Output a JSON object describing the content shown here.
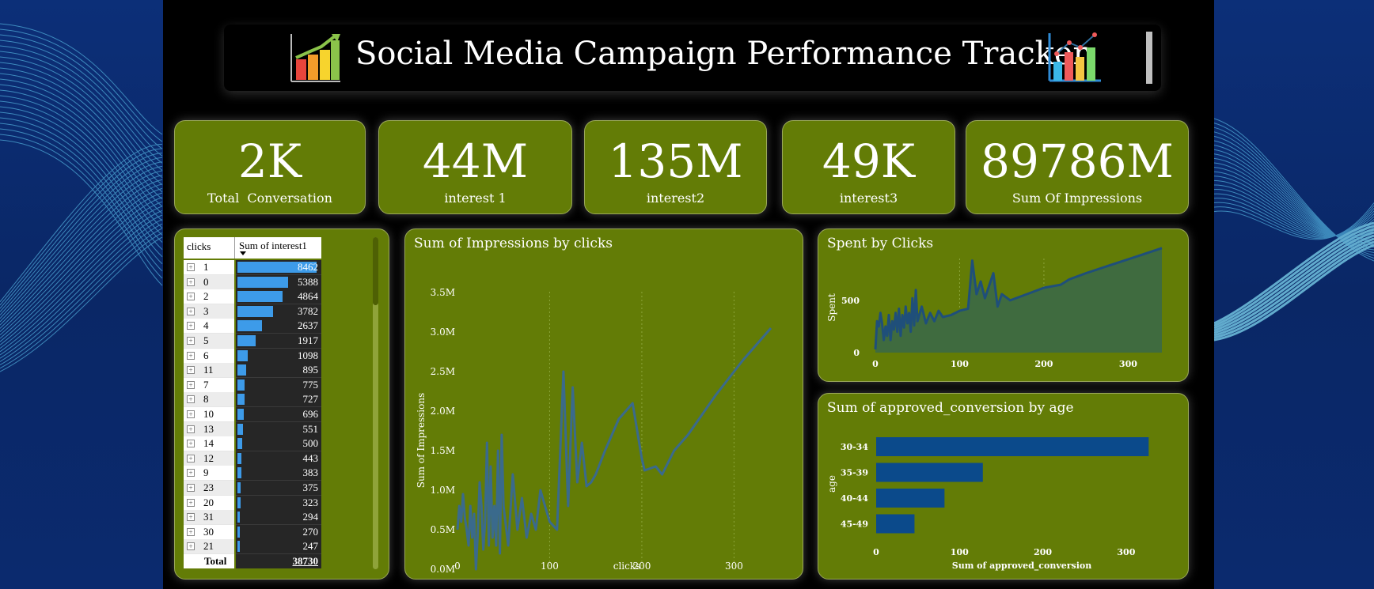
{
  "title": "Social Media Campaign Performance Tracker",
  "icons": {
    "left": "bar-chart-icon",
    "right": "growth-chart-icon"
  },
  "kpis": [
    {
      "value": "2K",
      "label": "Total  Conversation"
    },
    {
      "value": "44M",
      "label": "interest 1"
    },
    {
      "value": "135M",
      "label": "interest2"
    },
    {
      "value": "49K",
      "label": "interest3"
    },
    {
      "value": "89786M",
      "label": "Sum Of Impressions"
    }
  ],
  "pivot": {
    "col1": "clicks",
    "col2": "Sum of interest1",
    "rows": [
      {
        "k": "1",
        "v": 8462
      },
      {
        "k": "0",
        "v": 5388
      },
      {
        "k": "2",
        "v": 4864
      },
      {
        "k": "3",
        "v": 3782
      },
      {
        "k": "4",
        "v": 2637
      },
      {
        "k": "5",
        "v": 1917
      },
      {
        "k": "6",
        "v": 1098
      },
      {
        "k": "11",
        "v": 895
      },
      {
        "k": "7",
        "v": 775
      },
      {
        "k": "8",
        "v": 727
      },
      {
        "k": "10",
        "v": 696
      },
      {
        "k": "13",
        "v": 551
      },
      {
        "k": "14",
        "v": 500
      },
      {
        "k": "12",
        "v": 443
      },
      {
        "k": "9",
        "v": 383
      },
      {
        "k": "23",
        "v": 375
      },
      {
        "k": "20",
        "v": 323
      },
      {
        "k": "31",
        "v": 294
      },
      {
        "k": "30",
        "v": 270
      },
      {
        "k": "21",
        "v": 247
      }
    ],
    "total_label": "Total",
    "total_value": "38730",
    "expand_glyph": "+"
  },
  "colors": {
    "panel": "#637c06",
    "line": "#3a6a8c",
    "bar": "#0b4a8b",
    "area": "#3f6b3f",
    "pivot_bar": "#3d9be9"
  },
  "chart_data": [
    {
      "type": "line",
      "title": "Sum of Impressions by clicks",
      "xlabel": "clicks",
      "ylabel": "Sum of Impressions",
      "xlim": [
        0,
        340
      ],
      "ylim": [
        0,
        3500000
      ],
      "xticks": [
        "0",
        "100",
        "200",
        "300"
      ],
      "yticks": [
        "0.0M",
        "0.5M",
        "1.0M",
        "1.5M",
        "2.0M",
        "2.5M",
        "3.0M",
        "3.5M"
      ],
      "x": [
        0,
        2,
        4,
        6,
        8,
        10,
        12,
        14,
        16,
        18,
        20,
        22,
        24,
        26,
        28,
        30,
        32,
        34,
        36,
        38,
        40,
        42,
        44,
        46,
        48,
        50,
        55,
        60,
        65,
        70,
        75,
        80,
        85,
        90,
        95,
        100,
        108,
        115,
        120,
        125,
        130,
        135,
        140,
        145,
        150,
        160,
        175,
        190,
        200,
        203,
        215,
        222,
        235,
        250,
        280,
        310,
        340
      ],
      "values": [
        500000,
        800000,
        600000,
        950000,
        650000,
        500000,
        300000,
        800000,
        400000,
        700000,
        0,
        450000,
        1100000,
        800000,
        250000,
        600000,
        1600000,
        300000,
        1300000,
        400000,
        800000,
        300000,
        1500000,
        200000,
        1700000,
        800000,
        300000,
        1200000,
        500000,
        900000,
        400000,
        700000,
        500000,
        1000000,
        800000,
        600000,
        500000,
        2500000,
        800000,
        2300000,
        1100000,
        1600000,
        1050000,
        1100000,
        1200000,
        1500000,
        1900000,
        2100000,
        1400000,
        1250000,
        1300000,
        1200000,
        1500000,
        1700000,
        2200000,
        2650000,
        3050000
      ]
    },
    {
      "type": "area",
      "title": "Spent by Clicks",
      "ylabel": "Spent",
      "xlim": [
        0,
        340
      ],
      "ylim": [
        0,
        900
      ],
      "xticks": [
        "0",
        "100",
        "200",
        "300"
      ],
      "yticks": [
        "0",
        "500"
      ],
      "x": [
        0,
        2,
        4,
        6,
        8,
        10,
        12,
        14,
        16,
        18,
        20,
        22,
        24,
        26,
        28,
        30,
        32,
        34,
        36,
        38,
        40,
        42,
        44,
        46,
        48,
        50,
        55,
        60,
        65,
        70,
        75,
        80,
        90,
        100,
        110,
        115,
        120,
        125,
        130,
        140,
        145,
        150,
        160,
        180,
        200,
        220,
        230,
        250,
        280,
        310,
        340
      ],
      "values": [
        30,
        300,
        250,
        380,
        280,
        120,
        250,
        160,
        360,
        120,
        300,
        220,
        380,
        200,
        420,
        160,
        360,
        240,
        440,
        280,
        380,
        200,
        520,
        260,
        600,
        300,
        440,
        280,
        380,
        300,
        400,
        340,
        360,
        400,
        420,
        880,
        560,
        680,
        520,
        760,
        440,
        560,
        500,
        560,
        620,
        650,
        700,
        760,
        840,
        920,
        1000
      ]
    },
    {
      "type": "bar",
      "orientation": "horizontal",
      "title": "Sum of approved_conversion by age",
      "xlabel": "Sum of approved_conversion",
      "ylabel": "age",
      "xlim": [
        0,
        340
      ],
      "xticks": [
        "0",
        "100",
        "200",
        "300"
      ],
      "categories": [
        "30-34",
        "35-39",
        "40-44",
        "45-49"
      ],
      "values": [
        327,
        128,
        82,
        46
      ]
    }
  ]
}
